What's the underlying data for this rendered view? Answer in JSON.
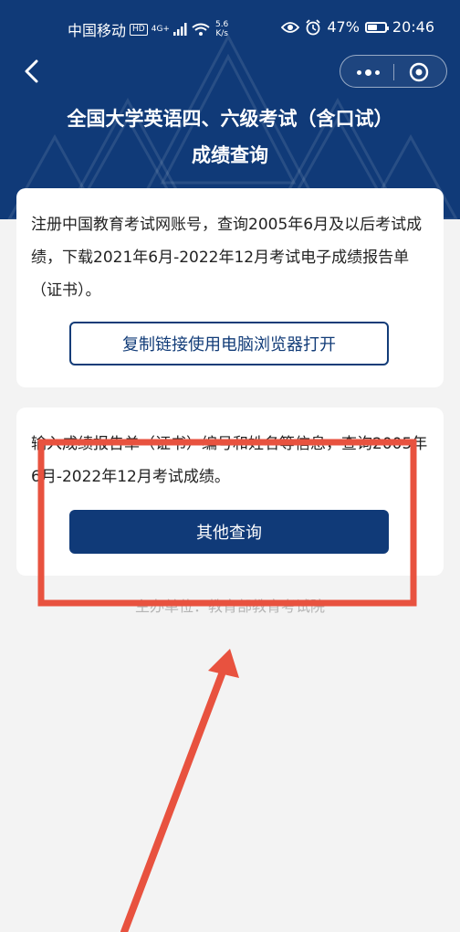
{
  "status_bar": {
    "carrier": "中国移动",
    "hd": "HD",
    "network": "4G+",
    "speed_value": "5.6",
    "speed_unit": "K/s",
    "battery": "47%",
    "time": "20:46"
  },
  "header": {
    "title_line1": "全国大学英语四、六级考试（含口试）",
    "title_line2": "成绩查询"
  },
  "card_register": {
    "text": "注册中国教育考试网账号，查询2005年6月及以后考试成绩，下载2021年6月-2022年12月考试电子成绩报告单（证书）。",
    "button_label": "复制链接使用电脑浏览器打开"
  },
  "card_other": {
    "text": "输入成绩报告单（证书）编号和姓名等信息，查询2005年6月-2022年12月考试成绩。",
    "button_label": "其他查询"
  },
  "footer": {
    "text": "主办单位：教育部教育考试院"
  },
  "colors": {
    "header_bg": "#103a78",
    "accent_button": "#103a78",
    "annotation_red": "#e8523f",
    "page_bg": "#f3f3f3"
  }
}
